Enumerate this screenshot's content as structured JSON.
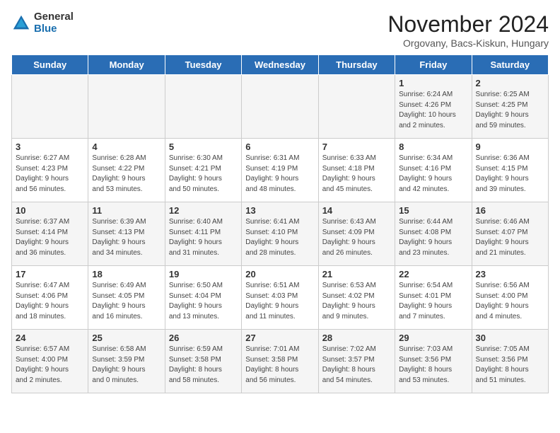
{
  "header": {
    "logo_general": "General",
    "logo_blue": "Blue",
    "title": "November 2024",
    "location": "Orgovany, Bacs-Kiskun, Hungary"
  },
  "days_of_week": [
    "Sunday",
    "Monday",
    "Tuesday",
    "Wednesday",
    "Thursday",
    "Friday",
    "Saturday"
  ],
  "weeks": [
    [
      {
        "day": "",
        "info": ""
      },
      {
        "day": "",
        "info": ""
      },
      {
        "day": "",
        "info": ""
      },
      {
        "day": "",
        "info": ""
      },
      {
        "day": "",
        "info": ""
      },
      {
        "day": "1",
        "info": "Sunrise: 6:24 AM\nSunset: 4:26 PM\nDaylight: 10 hours\nand 2 minutes."
      },
      {
        "day": "2",
        "info": "Sunrise: 6:25 AM\nSunset: 4:25 PM\nDaylight: 9 hours\nand 59 minutes."
      }
    ],
    [
      {
        "day": "3",
        "info": "Sunrise: 6:27 AM\nSunset: 4:23 PM\nDaylight: 9 hours\nand 56 minutes."
      },
      {
        "day": "4",
        "info": "Sunrise: 6:28 AM\nSunset: 4:22 PM\nDaylight: 9 hours\nand 53 minutes."
      },
      {
        "day": "5",
        "info": "Sunrise: 6:30 AM\nSunset: 4:21 PM\nDaylight: 9 hours\nand 50 minutes."
      },
      {
        "day": "6",
        "info": "Sunrise: 6:31 AM\nSunset: 4:19 PM\nDaylight: 9 hours\nand 48 minutes."
      },
      {
        "day": "7",
        "info": "Sunrise: 6:33 AM\nSunset: 4:18 PM\nDaylight: 9 hours\nand 45 minutes."
      },
      {
        "day": "8",
        "info": "Sunrise: 6:34 AM\nSunset: 4:16 PM\nDaylight: 9 hours\nand 42 minutes."
      },
      {
        "day": "9",
        "info": "Sunrise: 6:36 AM\nSunset: 4:15 PM\nDaylight: 9 hours\nand 39 minutes."
      }
    ],
    [
      {
        "day": "10",
        "info": "Sunrise: 6:37 AM\nSunset: 4:14 PM\nDaylight: 9 hours\nand 36 minutes."
      },
      {
        "day": "11",
        "info": "Sunrise: 6:39 AM\nSunset: 4:13 PM\nDaylight: 9 hours\nand 34 minutes."
      },
      {
        "day": "12",
        "info": "Sunrise: 6:40 AM\nSunset: 4:11 PM\nDaylight: 9 hours\nand 31 minutes."
      },
      {
        "day": "13",
        "info": "Sunrise: 6:41 AM\nSunset: 4:10 PM\nDaylight: 9 hours\nand 28 minutes."
      },
      {
        "day": "14",
        "info": "Sunrise: 6:43 AM\nSunset: 4:09 PM\nDaylight: 9 hours\nand 26 minutes."
      },
      {
        "day": "15",
        "info": "Sunrise: 6:44 AM\nSunset: 4:08 PM\nDaylight: 9 hours\nand 23 minutes."
      },
      {
        "day": "16",
        "info": "Sunrise: 6:46 AM\nSunset: 4:07 PM\nDaylight: 9 hours\nand 21 minutes."
      }
    ],
    [
      {
        "day": "17",
        "info": "Sunrise: 6:47 AM\nSunset: 4:06 PM\nDaylight: 9 hours\nand 18 minutes."
      },
      {
        "day": "18",
        "info": "Sunrise: 6:49 AM\nSunset: 4:05 PM\nDaylight: 9 hours\nand 16 minutes."
      },
      {
        "day": "19",
        "info": "Sunrise: 6:50 AM\nSunset: 4:04 PM\nDaylight: 9 hours\nand 13 minutes."
      },
      {
        "day": "20",
        "info": "Sunrise: 6:51 AM\nSunset: 4:03 PM\nDaylight: 9 hours\nand 11 minutes."
      },
      {
        "day": "21",
        "info": "Sunrise: 6:53 AM\nSunset: 4:02 PM\nDaylight: 9 hours\nand 9 minutes."
      },
      {
        "day": "22",
        "info": "Sunrise: 6:54 AM\nSunset: 4:01 PM\nDaylight: 9 hours\nand 7 minutes."
      },
      {
        "day": "23",
        "info": "Sunrise: 6:56 AM\nSunset: 4:00 PM\nDaylight: 9 hours\nand 4 minutes."
      }
    ],
    [
      {
        "day": "24",
        "info": "Sunrise: 6:57 AM\nSunset: 4:00 PM\nDaylight: 9 hours\nand 2 minutes."
      },
      {
        "day": "25",
        "info": "Sunrise: 6:58 AM\nSunset: 3:59 PM\nDaylight: 9 hours\nand 0 minutes."
      },
      {
        "day": "26",
        "info": "Sunrise: 6:59 AM\nSunset: 3:58 PM\nDaylight: 8 hours\nand 58 minutes."
      },
      {
        "day": "27",
        "info": "Sunrise: 7:01 AM\nSunset: 3:58 PM\nDaylight: 8 hours\nand 56 minutes."
      },
      {
        "day": "28",
        "info": "Sunrise: 7:02 AM\nSunset: 3:57 PM\nDaylight: 8 hours\nand 54 minutes."
      },
      {
        "day": "29",
        "info": "Sunrise: 7:03 AM\nSunset: 3:56 PM\nDaylight: 8 hours\nand 53 minutes."
      },
      {
        "day": "30",
        "info": "Sunrise: 7:05 AM\nSunset: 3:56 PM\nDaylight: 8 hours\nand 51 minutes."
      }
    ]
  ]
}
